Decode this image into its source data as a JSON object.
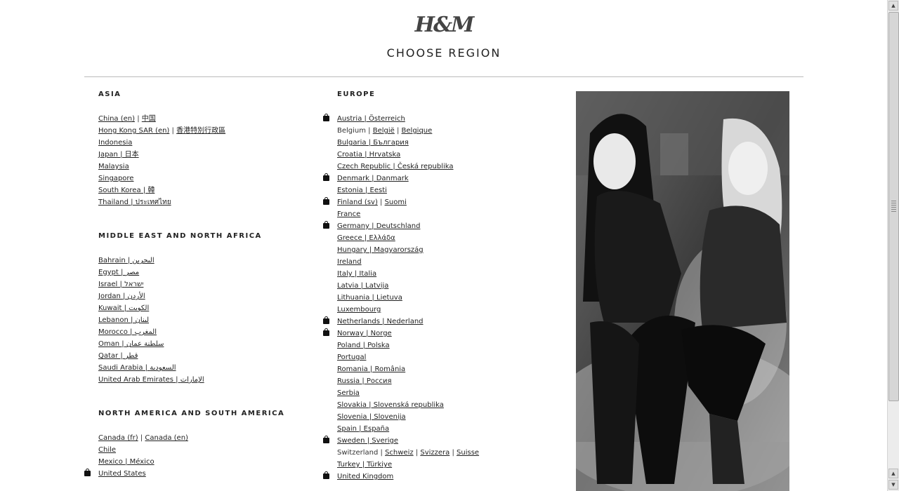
{
  "header": {
    "logo": "H&M",
    "title": "CHOOSE  REGION"
  },
  "asia": {
    "title": "ASIA",
    "items": [
      {
        "parts": [
          {
            "t": "China (en)",
            "link": true
          },
          {
            "t": " | "
          },
          {
            "t": "中国",
            "link": true
          }
        ]
      },
      {
        "parts": [
          {
            "t": "Hong Kong SAR (en)",
            "link": true
          },
          {
            "t": " | "
          },
          {
            "t": "香港特別行政區",
            "link": true
          }
        ]
      },
      {
        "parts": [
          {
            "t": "Indonesia",
            "link": true
          }
        ]
      },
      {
        "parts": [
          {
            "t": "Japan | 日本",
            "link": true
          }
        ]
      },
      {
        "parts": [
          {
            "t": "Malaysia",
            "link": true
          }
        ]
      },
      {
        "parts": [
          {
            "t": "Singapore",
            "link": true
          }
        ]
      },
      {
        "parts": [
          {
            "t": "South Korea | 韓",
            "link": true
          }
        ]
      },
      {
        "parts": [
          {
            "t": "Thailand | ประเทศไทย",
            "link": true
          }
        ]
      }
    ]
  },
  "mena": {
    "title": "MIDDLE EAST AND NORTH AFRICA",
    "items": [
      {
        "parts": [
          {
            "t": "Bahrain | البحرين",
            "link": true
          }
        ]
      },
      {
        "parts": [
          {
            "t": "Egypt | مصر",
            "link": true
          }
        ]
      },
      {
        "parts": [
          {
            "t": "Israel | ישראל",
            "link": true
          }
        ]
      },
      {
        "parts": [
          {
            "t": "Jordan | الأردن",
            "link": true
          }
        ]
      },
      {
        "parts": [
          {
            "t": "Kuwait | الكويت",
            "link": true
          }
        ]
      },
      {
        "parts": [
          {
            "t": "Lebanon | لبنان",
            "link": true
          }
        ]
      },
      {
        "parts": [
          {
            "t": "Morocco | المغرب",
            "link": true
          }
        ]
      },
      {
        "parts": [
          {
            "t": "Oman | سلطنة عمان",
            "link": true
          }
        ]
      },
      {
        "parts": [
          {
            "t": "Qatar | قطر",
            "link": true
          }
        ]
      },
      {
        "parts": [
          {
            "t": "Saudi Arabia | السعودية",
            "link": true
          }
        ]
      },
      {
        "parts": [
          {
            "t": "United Arab Emirates | الإمارات",
            "link": true
          }
        ]
      }
    ]
  },
  "americas": {
    "title": "NORTH AMERICA AND SOUTH AMERICA",
    "items": [
      {
        "parts": [
          {
            "t": "Canada (fr)",
            "link": true
          },
          {
            "t": " | "
          },
          {
            "t": "Canada (en)",
            "link": true
          }
        ]
      },
      {
        "parts": [
          {
            "t": "Chile",
            "link": true
          }
        ]
      },
      {
        "parts": [
          {
            "t": "Mexico | México",
            "link": true
          }
        ]
      },
      {
        "bag": true,
        "parts": [
          {
            "t": "United States",
            "link": true
          }
        ]
      }
    ]
  },
  "europe": {
    "title": "EUROPE",
    "items": [
      {
        "bag": true,
        "parts": [
          {
            "t": "Austria | Österreich",
            "link": true
          }
        ]
      },
      {
        "parts": [
          {
            "t": "Belgium | "
          },
          {
            "t": "België",
            "link": true
          },
          {
            "t": " | "
          },
          {
            "t": "Belgique",
            "link": true
          }
        ]
      },
      {
        "parts": [
          {
            "t": "Bulgaria | България",
            "link": true
          }
        ]
      },
      {
        "parts": [
          {
            "t": "Croatia | Hrvatska",
            "link": true
          }
        ]
      },
      {
        "parts": [
          {
            "t": "Czech Republic | Česká republika",
            "link": true
          }
        ]
      },
      {
        "bag": true,
        "parts": [
          {
            "t": "Denmark | Danmark",
            "link": true
          }
        ]
      },
      {
        "parts": [
          {
            "t": "Estonia | Eesti",
            "link": true
          }
        ]
      },
      {
        "bag": true,
        "parts": [
          {
            "t": "Finland (sv)",
            "link": true
          },
          {
            "t": " | "
          },
          {
            "t": "Suomi",
            "link": true
          }
        ]
      },
      {
        "parts": [
          {
            "t": "France",
            "link": true
          }
        ]
      },
      {
        "bag": true,
        "parts": [
          {
            "t": "Germany | Deutschland",
            "link": true
          }
        ]
      },
      {
        "parts": [
          {
            "t": "Greece | Ελλάδα",
            "link": true
          }
        ]
      },
      {
        "parts": [
          {
            "t": "Hungary | Magyarország",
            "link": true
          }
        ]
      },
      {
        "parts": [
          {
            "t": "Ireland",
            "link": true
          }
        ]
      },
      {
        "parts": [
          {
            "t": "Italy | Italia",
            "link": true
          }
        ]
      },
      {
        "parts": [
          {
            "t": "Latvia | Latvija",
            "link": true
          }
        ]
      },
      {
        "parts": [
          {
            "t": "Lithuania | Lietuva",
            "link": true
          }
        ]
      },
      {
        "parts": [
          {
            "t": "Luxembourg",
            "link": true
          }
        ]
      },
      {
        "bag": true,
        "parts": [
          {
            "t": "Netherlands | Nederland",
            "link": true
          }
        ]
      },
      {
        "bag": true,
        "parts": [
          {
            "t": "Norway | Norge",
            "link": true
          }
        ]
      },
      {
        "parts": [
          {
            "t": "Poland | Polska",
            "link": true
          }
        ]
      },
      {
        "parts": [
          {
            "t": "Portugal",
            "link": true
          }
        ]
      },
      {
        "parts": [
          {
            "t": "Romania | România",
            "link": true
          }
        ]
      },
      {
        "parts": [
          {
            "t": "Russia | Россия",
            "link": true
          }
        ]
      },
      {
        "parts": [
          {
            "t": "Serbia",
            "link": true
          }
        ]
      },
      {
        "parts": [
          {
            "t": "Slovakia | Slovenská republika",
            "link": true
          }
        ]
      },
      {
        "parts": [
          {
            "t": "Slovenia | Slovenija",
            "link": true
          }
        ]
      },
      {
        "parts": [
          {
            "t": "Spain | España",
            "link": true
          }
        ]
      },
      {
        "bag": true,
        "parts": [
          {
            "t": "Sweden | Sverige",
            "link": true
          }
        ]
      },
      {
        "parts": [
          {
            "t": "Switzerland | "
          },
          {
            "t": "Schweiz",
            "link": true
          },
          {
            "t": " | "
          },
          {
            "t": "Svizzera",
            "link": true
          },
          {
            "t": " | "
          },
          {
            "t": "Suisse",
            "link": true
          }
        ]
      },
      {
        "parts": [
          {
            "t": "Turkey | Türkiye",
            "link": true
          }
        ]
      },
      {
        "bag": true,
        "parts": [
          {
            "t": "United Kingdom",
            "link": true
          }
        ]
      }
    ]
  },
  "colors": {
    "text": "#222222",
    "rule": "#bbbbbb"
  },
  "icons": {
    "online_shop": "shopping-bag-icon"
  }
}
